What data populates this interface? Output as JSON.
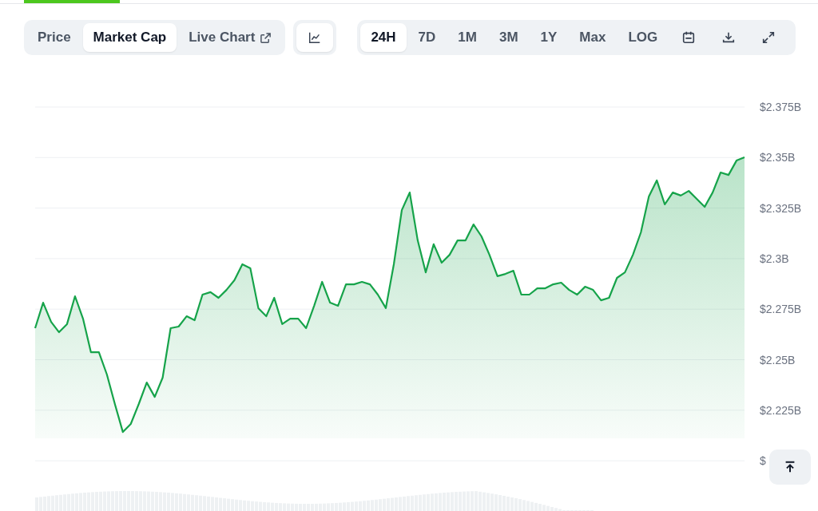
{
  "view_tabs": [
    {
      "label": "Price",
      "selected": false,
      "external": false
    },
    {
      "label": "Market Cap",
      "selected": true,
      "external": false
    },
    {
      "label": "Live Chart",
      "selected": false,
      "external": true
    }
  ],
  "ranges": [
    {
      "label": "24H",
      "selected": true
    },
    {
      "label": "7D",
      "selected": false
    },
    {
      "label": "1M",
      "selected": false
    },
    {
      "label": "3M",
      "selected": false
    },
    {
      "label": "1Y",
      "selected": false
    },
    {
      "label": "Max",
      "selected": false
    },
    {
      "label": "LOG",
      "selected": false
    }
  ],
  "chart": {
    "chart_data": {
      "type": "area",
      "ylim": [
        2.2,
        2.375
      ],
      "grid": true,
      "yticks": [
        {
          "value": 2.2,
          "label": "$"
        },
        {
          "value": 2.225,
          "label": "$2.225B"
        },
        {
          "value": 2.25,
          "label": "$2.25B"
        },
        {
          "value": 2.275,
          "label": "$2.275B"
        },
        {
          "value": 2.3,
          "label": "$2.3B"
        },
        {
          "value": 2.325,
          "label": "$2.325B"
        },
        {
          "value": 2.35,
          "label": "$2.35B"
        },
        {
          "value": 2.375,
          "label": "$2.375B"
        }
      ],
      "series": [
        {
          "color": "#16a34a",
          "values": [
            2.2656,
            2.2782,
            2.2687,
            2.2636,
            2.2676,
            2.2814,
            2.2703,
            2.2537,
            2.2537,
            2.2427,
            2.2281,
            2.2142,
            2.2182,
            2.2281,
            2.2387,
            2.2316,
            2.2411,
            2.2656,
            2.2664,
            2.2715,
            2.2695,
            2.2822,
            2.2834,
            2.2806,
            2.2845,
            2.2893,
            2.2972,
            2.2952,
            2.2755,
            2.2715,
            2.2806,
            2.2676,
            2.2703,
            2.2703,
            2.2656,
            2.2766,
            2.2885,
            2.2782,
            2.2766,
            2.2873,
            2.2873,
            2.2885,
            2.2873,
            2.2822,
            2.2755,
            2.2972,
            2.324,
            2.3327,
            2.309,
            2.2932,
            2.3071,
            2.298,
            2.3019,
            2.309,
            2.309,
            2.3169,
            2.311,
            2.3019,
            2.2913,
            2.2924,
            2.294,
            2.2822,
            2.2822,
            2.2853,
            2.2853,
            2.2873,
            2.2881,
            2.2845,
            2.2822,
            2.2861,
            2.2845,
            2.2794,
            2.2806,
            2.2905,
            2.2932,
            2.3019,
            2.313,
            2.3308,
            2.3387,
            2.3268,
            2.3327,
            2.3312,
            2.3335,
            2.3296,
            2.3256,
            2.3327,
            2.3426,
            2.3414,
            2.3485,
            2.3501
          ]
        }
      ]
    }
  }
}
